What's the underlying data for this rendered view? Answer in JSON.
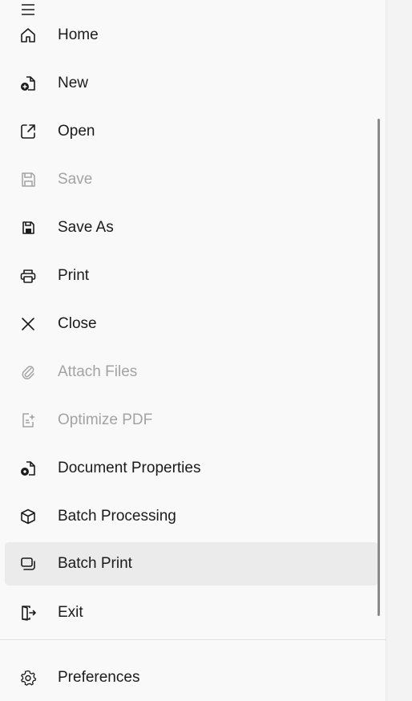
{
  "menu": {
    "items": [
      {
        "label": "Home",
        "icon": "home-icon",
        "enabled": true
      },
      {
        "label": "New",
        "icon": "new-document-icon",
        "enabled": true
      },
      {
        "label": "Open",
        "icon": "open-external-icon",
        "enabled": true
      },
      {
        "label": "Save",
        "icon": "save-icon",
        "enabled": false
      },
      {
        "label": "Save As",
        "icon": "save-as-icon",
        "enabled": true
      },
      {
        "label": "Print",
        "icon": "printer-icon",
        "enabled": true
      },
      {
        "label": "Close",
        "icon": "close-icon",
        "enabled": true
      },
      {
        "label": "Attach Files",
        "icon": "paperclip-icon",
        "enabled": false
      },
      {
        "label": "Optimize PDF",
        "icon": "optimize-pdf-icon",
        "enabled": false
      },
      {
        "label": "Document Properties",
        "icon": "document-settings-icon",
        "enabled": true
      },
      {
        "label": "Batch Processing",
        "icon": "cube-icon",
        "enabled": true
      },
      {
        "label": "Batch Print",
        "icon": "batch-print-icon",
        "enabled": true,
        "selected": true
      },
      {
        "label": "Exit",
        "icon": "exit-door-icon",
        "enabled": true
      }
    ],
    "footer": {
      "label": "Preferences",
      "icon": "gear-icon",
      "enabled": true
    }
  },
  "colors": {
    "text": "#1b1b1b",
    "disabled_text": "#a3a3a3",
    "selected_bg": "#ebebeb",
    "panel_bg": "#f9f9f9"
  }
}
